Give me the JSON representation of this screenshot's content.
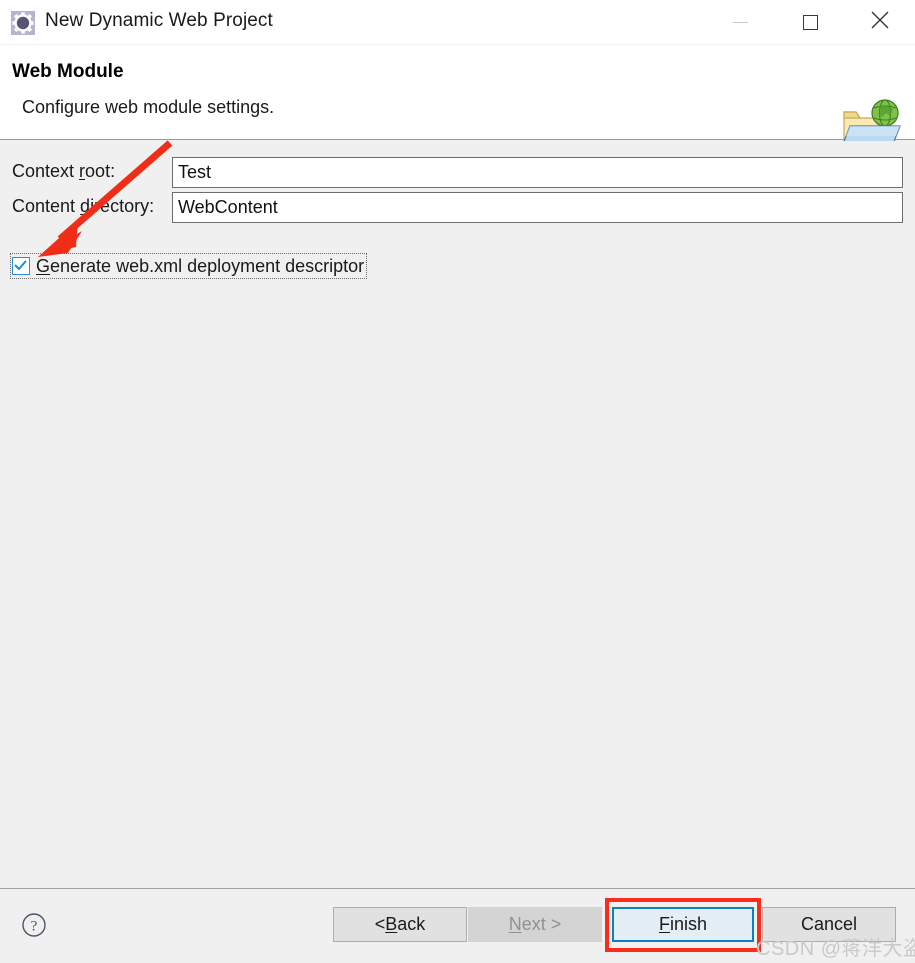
{
  "window": {
    "title": "New Dynamic Web Project",
    "icon": "gear-icon",
    "controls": {
      "minimize": "minimize-icon",
      "maximize": "maximize-icon",
      "close": "close-icon"
    }
  },
  "header": {
    "title": "Web Module",
    "description": "Configure web module settings.",
    "banner_icon": "web-folder-globe-icon"
  },
  "form": {
    "fields": [
      {
        "label_pre": "Context ",
        "label_mnemonic": "r",
        "label_post": "oot:",
        "value": "Test",
        "placeholder": ""
      },
      {
        "label_pre": "Content ",
        "label_mnemonic": "d",
        "label_post": "irectory:",
        "value": "WebContent",
        "placeholder": ""
      }
    ],
    "checkbox": {
      "checked": true,
      "label_mnemonic": "G",
      "label_post": "enerate web.xml deployment descriptor"
    }
  },
  "footer": {
    "help_icon": "help-question-icon",
    "buttons": [
      {
        "name": "back",
        "pre": "< ",
        "mnemonic": "B",
        "post": "ack",
        "enabled": true,
        "focused": false
      },
      {
        "name": "next",
        "pre": "",
        "mnemonic": "N",
        "post": "ext >",
        "enabled": false,
        "focused": false
      },
      {
        "name": "finish",
        "pre": "",
        "mnemonic": "F",
        "post": "inish",
        "enabled": true,
        "focused": true
      },
      {
        "name": "cancel",
        "pre": "",
        "mnemonic": "",
        "post": "Cancel",
        "enabled": true,
        "focused": false
      }
    ]
  },
  "annotations": {
    "arrow_color": "#f02d17",
    "highlight_color": "#fb2c1c",
    "watermark": "CSDN @蒋洋大盗"
  }
}
